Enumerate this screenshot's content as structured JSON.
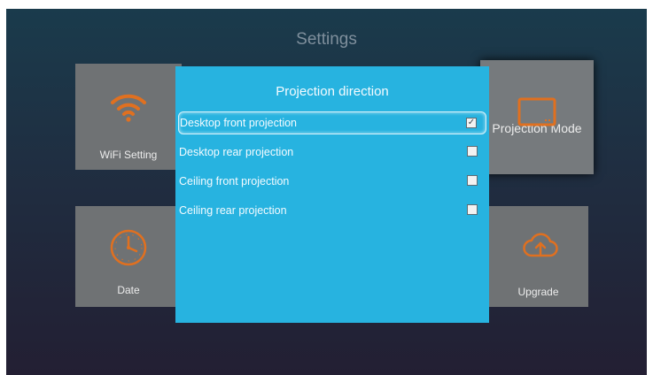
{
  "screen": {
    "title": "Settings"
  },
  "tiles": {
    "wifi": {
      "label": "WiFi Setting",
      "icon": "wifi-icon",
      "icon_color": "#e07020"
    },
    "date": {
      "label": "Date",
      "icon": "clock-icon",
      "icon_color": "#e07020"
    },
    "projection": {
      "label": "Projection Mode",
      "icon": "projector-screen-icon",
      "icon_color": "#e07020"
    },
    "upgrade": {
      "label": "Upgrade",
      "icon": "cloud-upload-icon",
      "icon_color": "#e07020"
    }
  },
  "dialog": {
    "title": "Projection direction",
    "options": [
      {
        "label": "Desktop front projection",
        "checked": true
      },
      {
        "label": "Desktop rear projection",
        "checked": false
      },
      {
        "label": "Ceiling front projection",
        "checked": false
      },
      {
        "label": "Ceiling rear projection",
        "checked": false
      }
    ],
    "background_color": "#27b3e0"
  }
}
